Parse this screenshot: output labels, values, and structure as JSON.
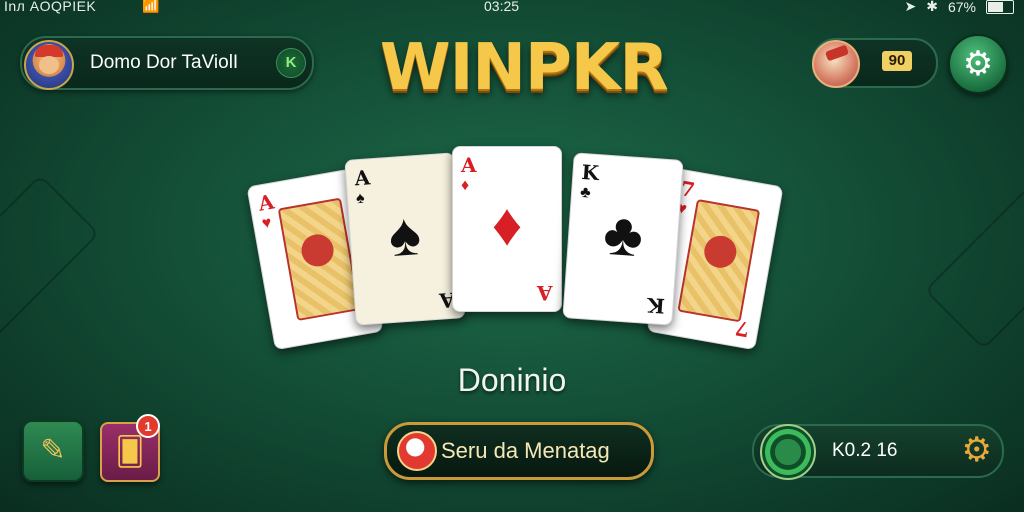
{
  "status_bar": {
    "carrier": "Inл AOQPIEK",
    "wifi_icon": "wifi-icon",
    "time": "03:25",
    "location_icon": "location-arrow-icon",
    "bluetooth_icon": "bluetooth-icon",
    "battery_percent_label": "67%",
    "battery_level": 0.67
  },
  "profile": {
    "name": "Domo Dor TaViolI",
    "badge": "K"
  },
  "logo": {
    "text": "WINPKR"
  },
  "coins": {
    "count": "90",
    "icon": "gift-box-icon"
  },
  "settings_icon": "gear-icon",
  "hand": {
    "cards": [
      {
        "rank": "A",
        "suit": "♥",
        "color": "red",
        "style": "face"
      },
      {
        "rank": "A",
        "suit": "♠",
        "color": "black",
        "style": "ace"
      },
      {
        "rank": "A",
        "suit": "♦",
        "color": "red",
        "style": "pip"
      },
      {
        "rank": "K",
        "suit": "♣",
        "color": "black",
        "style": "pip"
      },
      {
        "rank": "7",
        "suit": "♥",
        "color": "red",
        "style": "face"
      }
    ],
    "name": "Doninio"
  },
  "bottom_left": {
    "edit_icon": "pencil-icon",
    "cards_icon": "cards-icon",
    "notification_count": "1"
  },
  "action_button": {
    "label": "Seru da Menatag",
    "icon": "dice-icon"
  },
  "balance": {
    "value": "K0.2 16",
    "chip_icon": "chip-icon",
    "gear_icon": "gear-icon"
  },
  "colors": {
    "table_green": "#1e6b4a",
    "gold": "#f6c84a",
    "accent_red": "#d81f26"
  }
}
